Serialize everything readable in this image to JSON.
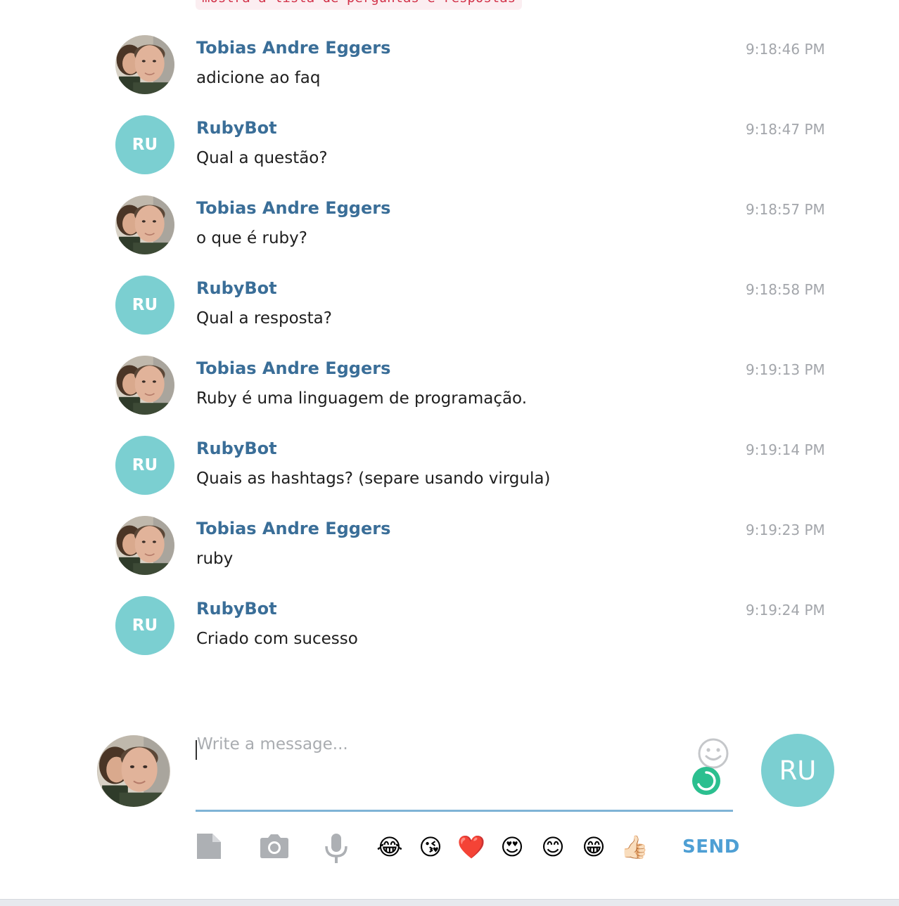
{
  "top_snippet": "mostra a lista de perguntas e respostas",
  "messages": [
    {
      "sender": "Tobias Andre Eggers",
      "time": "9:18:46 PM",
      "text": "adicione ao faq",
      "bot": false
    },
    {
      "sender": "RubyBot",
      "time": "9:18:47 PM",
      "text": "Qual a questão?",
      "bot": true,
      "initials": "RU"
    },
    {
      "sender": "Tobias Andre Eggers",
      "time": "9:18:57 PM",
      "text": "o que é ruby?",
      "bot": false
    },
    {
      "sender": "RubyBot",
      "time": "9:18:58 PM",
      "text": "Qual a resposta?",
      "bot": true,
      "initials": "RU"
    },
    {
      "sender": "Tobias Andre Eggers",
      "time": "9:19:13 PM",
      "text": "Ruby é uma linguagem de programação.",
      "bot": false
    },
    {
      "sender": "RubyBot",
      "time": "9:19:14 PM",
      "text": "Quais as hashtags? (separe usando virgula)",
      "bot": true,
      "initials": "RU"
    },
    {
      "sender": "Tobias Andre Eggers",
      "time": "9:19:23 PM",
      "text": "ruby",
      "bot": false
    },
    {
      "sender": "RubyBot",
      "time": "9:19:24 PM",
      "text": "Criado com sucesso",
      "bot": true,
      "initials": "RU"
    }
  ],
  "composer": {
    "placeholder": "Write a message...",
    "value": "",
    "send_label": "SEND",
    "send_avatar_initials": "RU"
  },
  "toolbar": {
    "icons": [
      "file-icon",
      "camera-icon",
      "microphone-icon"
    ],
    "emojis": [
      "😂",
      "😘",
      "❤️",
      "😍",
      "😊",
      "😁",
      "👍🏻"
    ]
  },
  "colors": {
    "bot_avatar": "#7bcfd1",
    "sender_name": "#3a6e98",
    "timestamp": "#a3a6ab",
    "input_underline": "#7fb3d6",
    "send_button": "#4e9fd4",
    "status_dot": "#2bbf8f"
  }
}
